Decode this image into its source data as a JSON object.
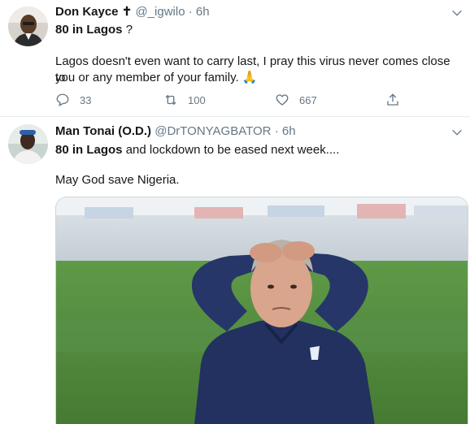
{
  "tweets": [
    {
      "display_name": "Don Kayce",
      "verified_glyph": "✝",
      "handle": "@_igwilo",
      "separator": "·",
      "time": "6h",
      "line1_bold": "80 in Lagos",
      "line1_rest": " ?",
      "line2": "Lagos doesn't even want to carry last, I pray this virus never comes close to",
      "line3": "you or any member of your family.",
      "emoji": "🙏",
      "reply_count": "33",
      "retweet_count": "100",
      "like_count": "667"
    },
    {
      "display_name": "Man Tonai (O.D.)",
      "handle": "@DrTONYAGBATOR",
      "separator": "·",
      "time": "6h",
      "line1_bold": "80 in Lagos",
      "line1_rest": " and lockdown to be eased next week....",
      "line2": "May God save Nigeria."
    }
  ],
  "icons": [
    "reply-icon",
    "retweet-icon",
    "like-icon",
    "share-icon",
    "chevron-down-icon"
  ],
  "colors": {
    "muted": "#657786",
    "text": "#14171a",
    "divider": "#e6ecf0",
    "pitch": "#4f8a3a",
    "jacket": "#22315f"
  }
}
